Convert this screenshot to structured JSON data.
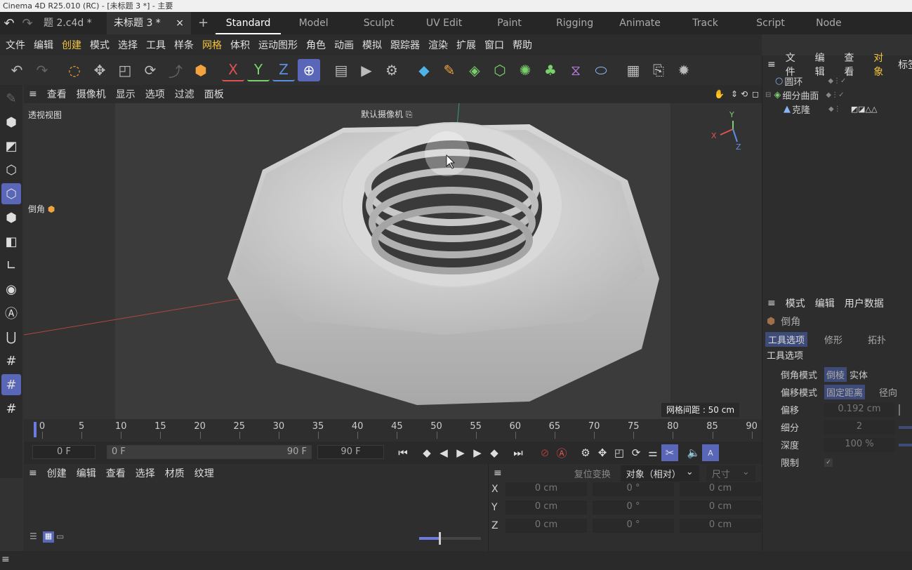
{
  "window": {
    "title": "Cinema 4D R25.010 (RC) - [未标题 3 *] - 主要"
  },
  "tabs": {
    "doc1": "题 2.c4d *",
    "doc2": "未标题 3 *",
    "close": "×",
    "add": "+"
  },
  "layouts": [
    "Standard",
    "Model",
    "Sculpt",
    "UV Edit",
    "Paint",
    "Rigging",
    "Animate",
    "Track",
    "Script",
    "Node"
  ],
  "menu": [
    "文件",
    "编辑",
    "创建",
    "模式",
    "选择",
    "工具",
    "样条",
    "网格",
    "体积",
    "运动图形",
    "角色",
    "动画",
    "模拟",
    "跟踪器",
    "渲染",
    "扩展",
    "窗口",
    "帮助"
  ],
  "axes": {
    "x": "X",
    "y": "Y",
    "z": "Z"
  },
  "viewport": {
    "menu": [
      "查看",
      "摄像机",
      "显示",
      "选项",
      "过滤",
      "面板"
    ],
    "view_name": "透视视图",
    "camera": "默认摄像机",
    "tool_label": "倒角",
    "grid_spacing": "网格间距 : 50 cm",
    "gizmo": {
      "x": "X",
      "y": "Y",
      "z": "Z"
    }
  },
  "timeline": {
    "ticks": [
      "0",
      "5",
      "10",
      "15",
      "20",
      "25",
      "30",
      "35",
      "40",
      "45",
      "50",
      "55",
      "60",
      "65",
      "70",
      "75",
      "80",
      "85",
      "90"
    ]
  },
  "transport": {
    "current": "0 F",
    "range_start": "0 F",
    "range_end": "90 F",
    "end": "90 F"
  },
  "materials": {
    "menu": [
      "创建",
      "编辑",
      "查看",
      "选择",
      "材质",
      "纹理"
    ]
  },
  "coords": {
    "reset": "复位变换",
    "mode": "对象（相对）",
    "size": "尺寸",
    "rows": [
      {
        "axis": "X",
        "pos": "0 cm",
        "rot": "0 °",
        "size": "0 cm"
      },
      {
        "axis": "Y",
        "pos": "0 cm",
        "rot": "0 °",
        "size": "0 cm"
      },
      {
        "axis": "Z",
        "pos": "0 cm",
        "rot": "0 °",
        "size": "0 cm"
      }
    ]
  },
  "objects": {
    "menu": [
      "文件",
      "编辑",
      "查看",
      "对象",
      "标签"
    ],
    "items": [
      {
        "name": "圆环"
      },
      {
        "name": "细分曲面"
      },
      {
        "name": "克隆"
      }
    ]
  },
  "attributes": {
    "menu": [
      "模式",
      "编辑",
      "用户数据"
    ],
    "tool_name": "倒角",
    "tabs": [
      "工具选项",
      "修形",
      "拓扑"
    ],
    "section": "工具选项",
    "bevel_mode": {
      "label": "倒角模式",
      "opt1": "倒棱",
      "opt2": "实体"
    },
    "offset_mode": {
      "label": "偏移模式",
      "opt1": "固定距离",
      "opt2": "径向"
    },
    "offset": {
      "label": "偏移",
      "value": "0.192 cm"
    },
    "subdivision": {
      "label": "细分",
      "value": "2"
    },
    "depth": {
      "label": "深度",
      "value": "100 %"
    },
    "limit": {
      "label": "限制",
      "value": "✓"
    }
  }
}
